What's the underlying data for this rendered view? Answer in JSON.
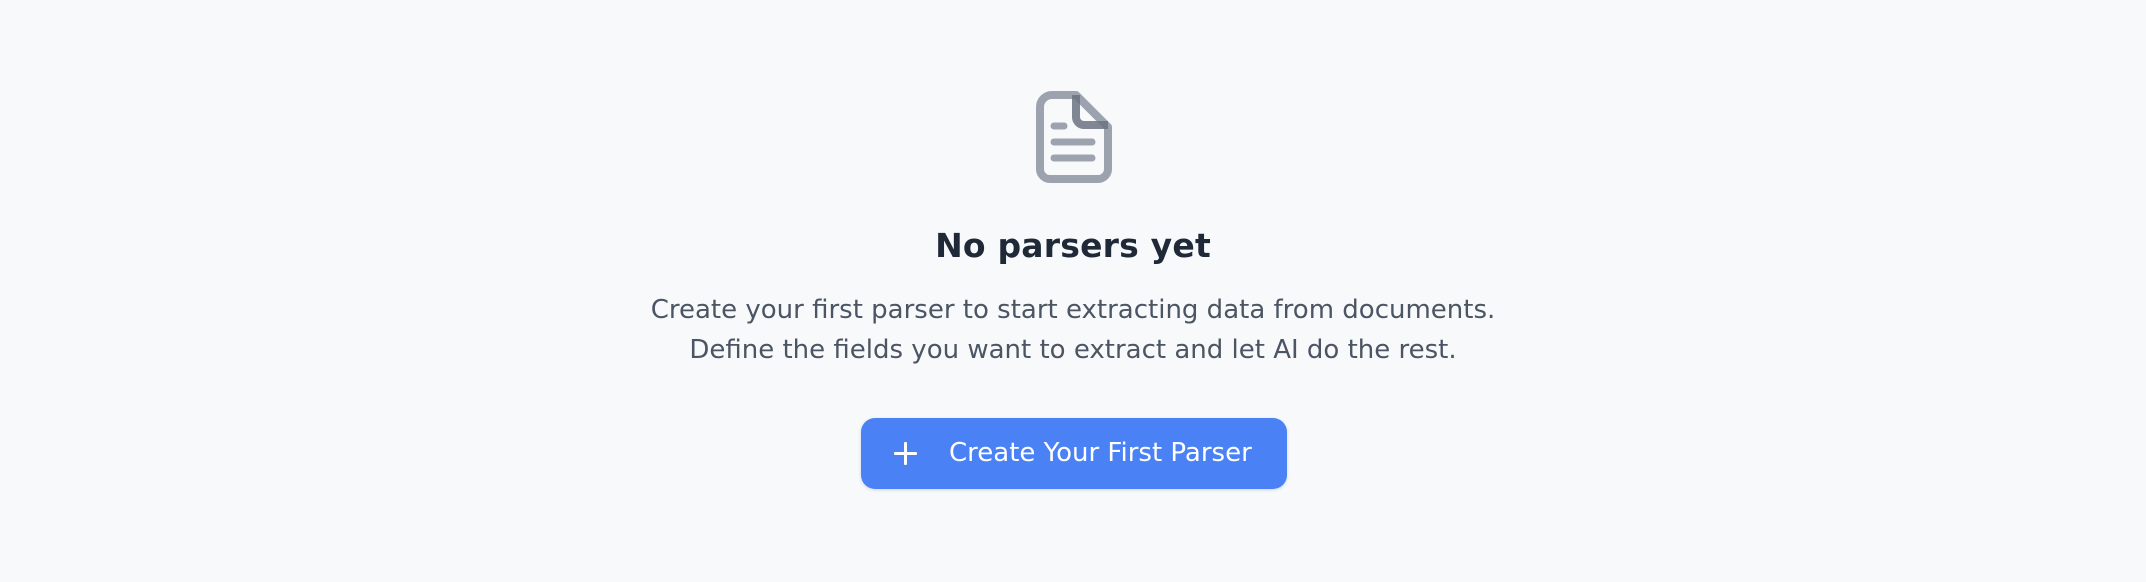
{
  "empty_state": {
    "icon": "document-icon",
    "title": "No parsers yet",
    "description_lines": [
      "Create your first parser to start extracting data from documents.",
      "Define the fields you want to extract and let AI do the rest."
    ],
    "button": {
      "icon": "plus-icon",
      "label": "Create Your First Parser"
    }
  },
  "colors": {
    "background": "#f8f9fb",
    "icon": "#9ca3af",
    "title": "#1f2937",
    "description": "#4b5563",
    "button": "#4a82f6",
    "button_text": "#ffffff"
  }
}
